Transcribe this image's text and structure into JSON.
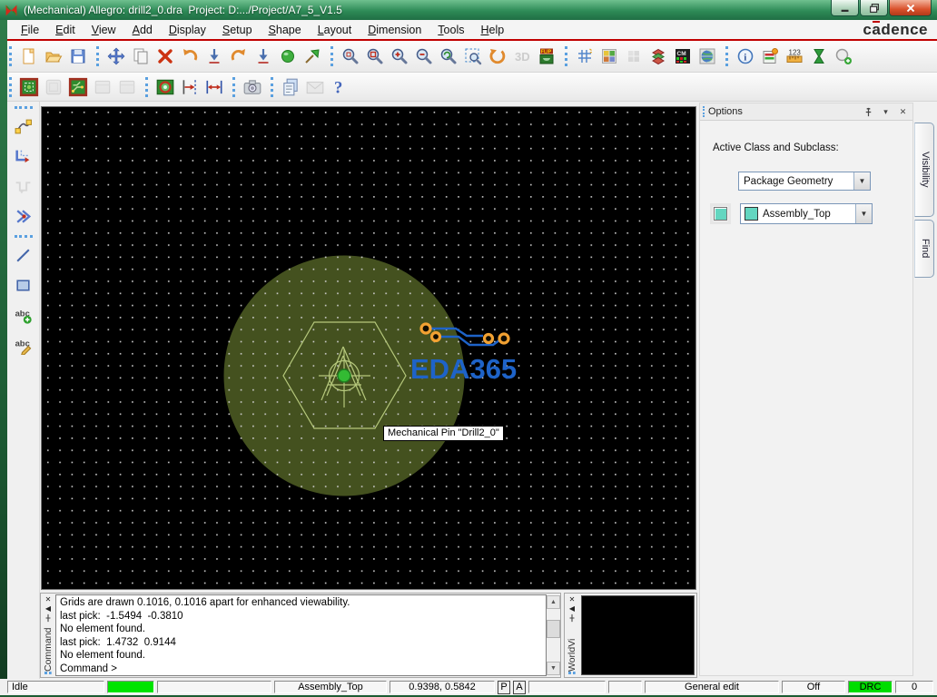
{
  "window": {
    "title": "(Mechanical) Allegro: drill2_0.dra  Project: D:.../Project/A7_5_V1.5"
  },
  "brand": {
    "prefix": "c",
    "accent_letter": "a",
    "suffix": "dence"
  },
  "menu": {
    "items": [
      "File",
      "Edit",
      "View",
      "Add",
      "Display",
      "Setup",
      "Shape",
      "Layout",
      "Dimension",
      "Tools",
      "Help"
    ]
  },
  "toolbars": {
    "main": [
      {
        "items": [
          {
            "name": "new-drawing",
            "icon": "new"
          },
          {
            "name": "open-drawing",
            "icon": "open"
          },
          {
            "name": "save-drawing",
            "icon": "save"
          }
        ]
      },
      {
        "items": [
          {
            "name": "move",
            "icon": "move"
          },
          {
            "name": "copy",
            "icon": "copy"
          },
          {
            "name": "delete",
            "icon": "delete"
          },
          {
            "name": "undo",
            "icon": "undo"
          },
          {
            "name": "cancel",
            "icon": "arrow-down-bar"
          },
          {
            "name": "redo",
            "icon": "redo"
          },
          {
            "name": "done",
            "icon": "arrow-down-bar"
          },
          {
            "name": "highlight",
            "icon": "highlight"
          },
          {
            "name": "fix",
            "icon": "pin-dart"
          }
        ]
      },
      {
        "items": [
          {
            "name": "zoom-points",
            "icon": "zoom-points"
          },
          {
            "name": "zoom-fit",
            "icon": "zoom-fit"
          },
          {
            "name": "zoom-in",
            "icon": "zoom-in"
          },
          {
            "name": "zoom-out",
            "icon": "zoom-out"
          },
          {
            "name": "zoom-previous",
            "icon": "zoom-previous"
          },
          {
            "name": "zoom-selection",
            "icon": "zoom-selection"
          },
          {
            "name": "redraw",
            "icon": "redraw"
          },
          {
            "name": "view-3d",
            "icon": "threed",
            "disabled": true
          },
          {
            "name": "flip-design",
            "icon": "flip"
          }
        ]
      },
      {
        "items": [
          {
            "name": "grid-toggle",
            "icon": "grid"
          },
          {
            "name": "color-dialog",
            "icon": "colors"
          },
          {
            "name": "shadow-mode",
            "icon": "shadow",
            "disabled": true
          },
          {
            "name": "layer-priority",
            "icon": "layers"
          },
          {
            "name": "color-matrix",
            "icon": "cm"
          },
          {
            "name": "world-view-toggle",
            "icon": "world"
          }
        ]
      },
      {
        "items": [
          {
            "name": "show-element",
            "icon": "info"
          },
          {
            "name": "show-status",
            "icon": "status"
          },
          {
            "name": "show-measure",
            "icon": "measure"
          },
          {
            "name": "waive-drc",
            "icon": "hourglass"
          },
          {
            "name": "snap-pick",
            "icon": "snap"
          }
        ]
      }
    ],
    "second": [
      {
        "items": [
          {
            "name": "select-shape",
            "icon": "board-select"
          },
          {
            "name": "shape-tool-2",
            "icon": "board-gray",
            "disabled": true
          },
          {
            "name": "route-display",
            "icon": "board-route"
          },
          {
            "name": "shape-tool-4",
            "icon": "gray-frame",
            "disabled": true
          },
          {
            "name": "shape-tool-5",
            "icon": "gray-frame",
            "disabled": true
          }
        ]
      },
      {
        "items": [
          {
            "name": "padstack",
            "icon": "padstack"
          },
          {
            "name": "dimension-linear",
            "icon": "dim-linear"
          },
          {
            "name": "dimension-distance",
            "icon": "dim-span"
          }
        ]
      },
      {
        "items": [
          {
            "name": "snapshot",
            "icon": "camera"
          }
        ]
      },
      {
        "items": [
          {
            "name": "journal",
            "icon": "journal"
          },
          {
            "name": "mail",
            "icon": "mail",
            "disabled": true
          },
          {
            "name": "help",
            "icon": "help"
          }
        ]
      }
    ],
    "left": [
      {
        "items": [
          {
            "name": "add-connect",
            "icon": "connect"
          },
          {
            "name": "slide",
            "icon": "slide"
          },
          {
            "name": "delay-tune",
            "icon": "tune",
            "disabled": true
          },
          {
            "name": "vertex",
            "icon": "vertex"
          }
        ]
      },
      {
        "items": [
          {
            "name": "add-line",
            "icon": "line"
          },
          {
            "name": "add-rectangle",
            "icon": "rect"
          },
          {
            "name": "add-text",
            "icon": "text-add"
          },
          {
            "name": "edit-text",
            "icon": "text-edit"
          }
        ]
      }
    ]
  },
  "canvas": {
    "tooltip": "Mechanical Pin \"Drill2_0\"",
    "logo_text": "EDA365",
    "colors": {
      "background": "#000000",
      "grid_dot": "#cfcfcf",
      "pin_highlight": "#44511f",
      "symbol_outline": "#b6c87c",
      "center_pad": "#33bb33",
      "logo_blue": "#1e63c8",
      "pad_orange": "#f2a132"
    }
  },
  "options_panel": {
    "title": "Options",
    "label": "Active Class and Subclass:",
    "class_value": "Package Geometry",
    "subclass_value": "Assembly_Top",
    "subclass_color": "#63d6c0",
    "collapse_glyph": "▾",
    "close_glyph": "✕"
  },
  "side_tabs": [
    {
      "label": "Visibility"
    },
    {
      "label": "Find"
    }
  ],
  "command_panel": {
    "title": "Command",
    "lines": [
      "Grids are drawn 0.1016, 0.1016 apart for enhanced viewability.",
      "last pick:  -1.5494  -0.3810",
      "No element found.",
      "last pick:  1.4732  0.9144",
      "No element found."
    ],
    "prompt": "Command >"
  },
  "worldview_panel": {
    "title": "WorldVi"
  },
  "status_bar": {
    "cells": [
      {
        "name": "command-state",
        "label": "Idle",
        "kind": "left"
      },
      {
        "name": "progress-indicator",
        "label": "",
        "kind": "progress"
      },
      {
        "name": "spare-1",
        "label": "",
        "kind": "plain"
      },
      {
        "name": "active-subclass",
        "label": "Assembly_Top",
        "kind": "plain"
      },
      {
        "name": "cursor-coords",
        "label": "0.9398, 0.5842",
        "kind": "plain"
      },
      {
        "name": "pick-grid-p",
        "label": "P",
        "kind": "mini-btn"
      },
      {
        "name": "pick-angle-a",
        "label": "A",
        "kind": "mini-btn"
      },
      {
        "name": "spare-2",
        "label": "",
        "kind": "plain"
      },
      {
        "name": "spare-3",
        "label": "",
        "kind": "plain"
      },
      {
        "name": "edit-mode",
        "label": "General edit",
        "kind": "plain"
      },
      {
        "name": "superfilter",
        "label": "Off",
        "kind": "plain"
      },
      {
        "name": "drc-status",
        "label": "DRC",
        "kind": "drc"
      },
      {
        "name": "drc-count",
        "label": "0",
        "kind": "plain"
      }
    ]
  }
}
